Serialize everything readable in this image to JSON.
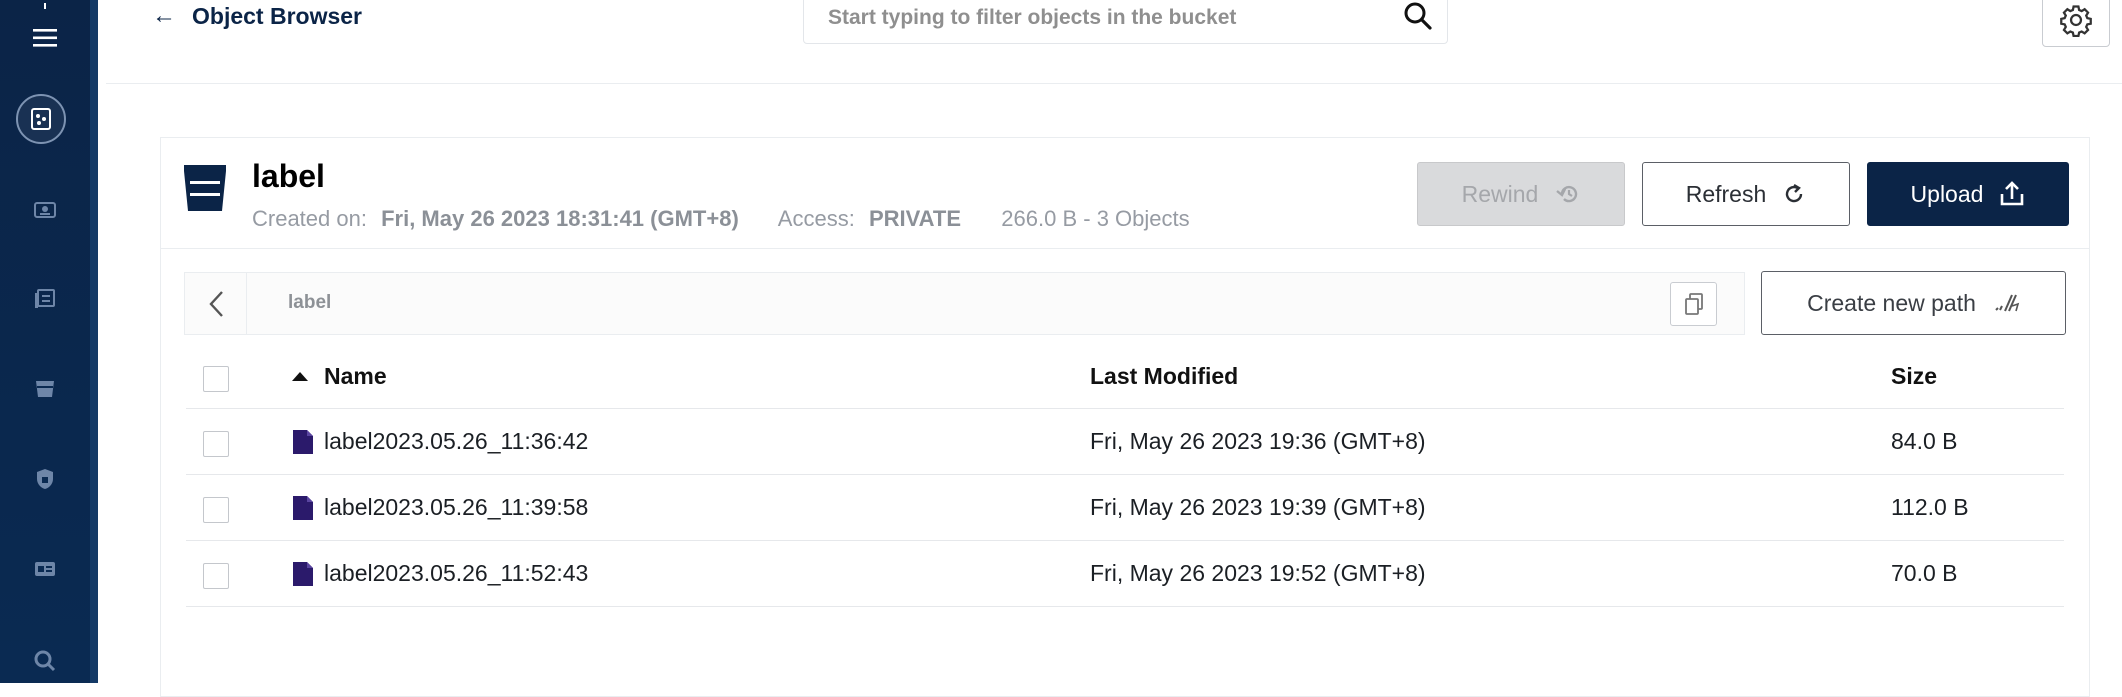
{
  "header": {
    "back_label": "Object Browser",
    "search_placeholder": "Start typing to filter objects in the bucket"
  },
  "sidebar": {
    "items": [
      "menu-icon",
      "object-browser-icon",
      "identity-icon",
      "logs-icon",
      "buckets-icon",
      "policies-icon",
      "license-icon",
      "diagnostics-icon"
    ]
  },
  "bucket": {
    "name": "label",
    "created_label": "Created on:",
    "created_value": "Fri, May 26 2023 18:31:41 (GMT+8)",
    "access_label": "Access:",
    "access_value": "PRIVATE",
    "summary": "266.0 B - 3 Objects"
  },
  "actions": {
    "rewind": "Rewind",
    "refresh": "Refresh",
    "upload": "Upload",
    "create_path": "Create new path"
  },
  "path": {
    "current": "label"
  },
  "table": {
    "columns": {
      "name": "Name",
      "modified": "Last Modified",
      "size": "Size"
    },
    "rows": [
      {
        "name": "label2023.05.26_11:36:42",
        "modified": "Fri, May 26 2023 19:36 (GMT+8)",
        "size": "84.0 B"
      },
      {
        "name": "label2023.05.26_11:39:58",
        "modified": "Fri, May 26 2023 19:39 (GMT+8)",
        "size": "112.0 B"
      },
      {
        "name": "label2023.05.26_11:52:43",
        "modified": "Fri, May 26 2023 19:52 (GMT+8)",
        "size": "70.0 B"
      }
    ]
  },
  "colors": {
    "primary": "#0b2447",
    "file_icon": "#2b1a6b",
    "disabled": "#d9dadc"
  }
}
